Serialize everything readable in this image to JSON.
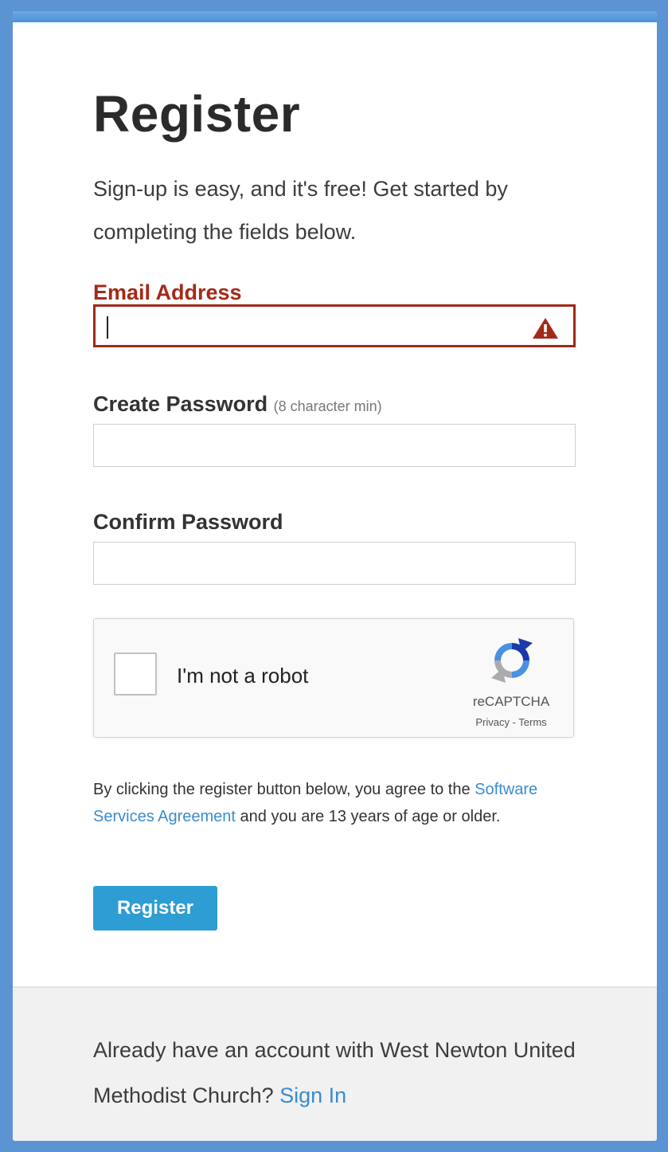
{
  "page": {
    "title": "Register"
  },
  "intro": "Sign-up is easy, and it's free! Get started by completing the fields below.",
  "fields": {
    "email": {
      "label": "Email Address",
      "value": ""
    },
    "password": {
      "label": "Create Password",
      "hint": "(8 character min)",
      "value": ""
    },
    "confirm": {
      "label": "Confirm Password",
      "value": ""
    }
  },
  "captcha": {
    "label": "I'm not a robot",
    "brand": "reCAPTCHA",
    "privacy": "Privacy",
    "separator": " - ",
    "terms": "Terms"
  },
  "terms": {
    "before": "By clicking the register button below, you agree to the ",
    "link": "Software Services Agreement",
    "after": " and you are 13 years of age or older."
  },
  "submit": {
    "label": "Register"
  },
  "footer": {
    "text": "Already have an account with West Newton United Methodist Church? ",
    "link": "Sign In"
  },
  "colors": {
    "error": "#a32a18",
    "link": "#3a8ccf",
    "button": "#2e9dd3",
    "accent": "#5b93d3"
  },
  "icons": {
    "email_error": "warning-icon",
    "captcha": "recaptcha-icon"
  }
}
